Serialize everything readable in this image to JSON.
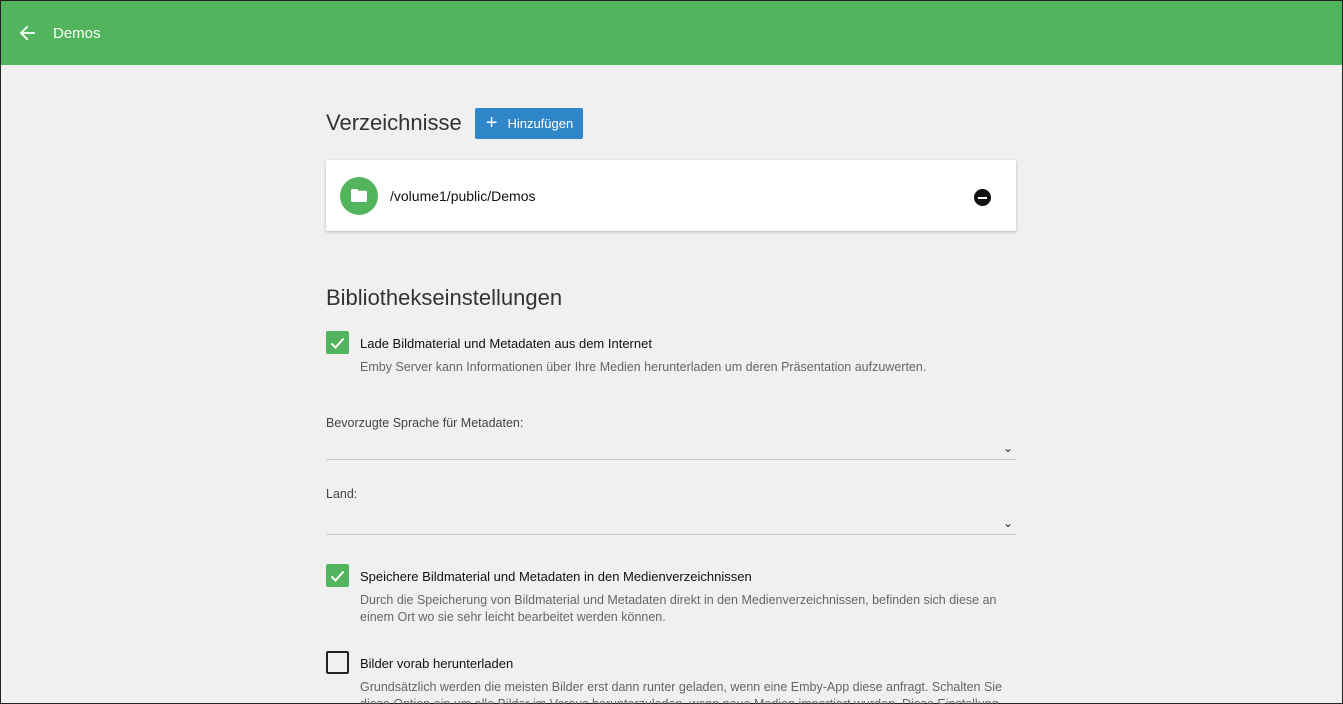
{
  "appbar": {
    "title": "Demos",
    "color": "#52b55e"
  },
  "folders": {
    "title": "Verzeichnisse",
    "add_label": "Hinzufügen",
    "items": [
      {
        "path": "/volume1/public/Demos"
      }
    ]
  },
  "settings": {
    "title": "Bibliothekseinstellungen",
    "download_internet": {
      "checked": true,
      "label": "Lade Bildmaterial und Metadaten aus dem Internet",
      "description": "Emby Server kann Informationen über Ihre Medien herunterladen um deren Präsentation aufzuwerten."
    },
    "language": {
      "label": "Bevorzugte Sprache für Metadaten:",
      "value": ""
    },
    "country": {
      "label": "Land:",
      "value": ""
    },
    "save_local": {
      "checked": true,
      "label": "Speichere Bildmaterial und Metadaten in den Medienverzeichnissen",
      "description": "Durch die Speicherung von Bildmaterial und Metadaten direkt in den Medienverzeichnissen, befinden sich diese an einem Ort wo sie sehr leicht bearbeitet werden können."
    },
    "predownload": {
      "checked": false,
      "label": "Bilder vorab herunterladen",
      "description": "Grundsätzlich werden die meisten Bilder erst dann runter geladen, wenn eine Emby-App diese anfragt. Schalten Sie diese Option ein um alle Bilder im Voraus herunterzuladen, wenn neue Medien importiert wurden. Diese Einstellung kann zu signifikant längeren Bibliothekscans führen."
    }
  }
}
